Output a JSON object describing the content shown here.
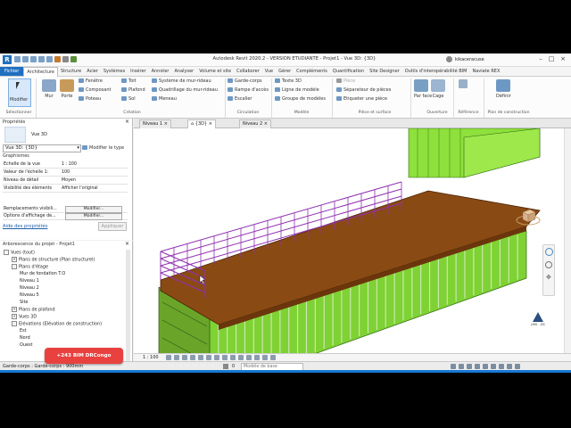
{
  "window": {
    "title": "Autodesk Revit 2020.2 - VERSION ETUDIANTE - Projet1 - Vue 3D: {3D}",
    "user": "kikaceracuse"
  },
  "tabs": [
    "Fichier",
    "Architecture",
    "Structure",
    "Acier",
    "Systèmes",
    "Insérer",
    "Annoter",
    "Analyser",
    "Volume et site",
    "Collaborer",
    "Vue",
    "Gérer",
    "Compléments",
    "Quantification",
    "Site Designer",
    "Outils d'interopérabilité BIM",
    "Naviate REX"
  ],
  "ribbon": {
    "select": {
      "modify": "Modifier",
      "label": "Sélectionner"
    },
    "build": {
      "wall": "Mur",
      "door": "Porte",
      "window": "Fenêtre",
      "component": "Composant",
      "column": "Poteau",
      "roof": "Toit",
      "ceiling": "Plafond",
      "floor": "Sol",
      "curtain_system": "Système de mur-rideau",
      "curtain_grid": "Quadrillage du mur-rideau",
      "mullion": "Meneau",
      "label": "Création"
    },
    "circulation": {
      "railing": "Garde-corps",
      "ramp": "Rampe d'accès",
      "stair": "Escalier",
      "label": "Circulation"
    },
    "model": {
      "model_text": "Texte 3D",
      "model_line": "Ligne de modèle",
      "model_group": "Groupe de modèles",
      "label": "Modèle"
    },
    "room": {
      "room": "Pièce",
      "separator": "Séparateur de pièces",
      "tag": "Etiqueter une pièce",
      "label": "Pièce et surface"
    },
    "opening": {
      "by_face": "Par face",
      "shaft": "Cage",
      "label": "Ouverture"
    },
    "datum": {
      "label": "Référence"
    },
    "work_plane": {
      "set": "Définir",
      "label": "Plan de construction"
    }
  },
  "properties": {
    "title": "Propriétés",
    "type_name": "Vue 3D",
    "selector": "Vue 3D: {3D}",
    "edit_type": "Modifier le type",
    "section": "Graphismes",
    "rows": [
      {
        "k": "Echelle de la vue",
        "v": "1 : 100"
      },
      {
        "k": "Valeur de l'échelle    1:",
        "v": "100"
      },
      {
        "k": "Niveau de détail",
        "v": "Moyen"
      },
      {
        "k": "Visibilité des éléments",
        "v": "Afficher l'original"
      }
    ],
    "vg_overrides": "Remplacements visibili...",
    "vg_button": "Modifier...",
    "display_options": "Options d'affichage de...",
    "display_button": "Modifier...",
    "help": "Aide des propriétés",
    "apply": "Appliquer"
  },
  "browser": {
    "title": "Arborescence du projet - Projet1",
    "items": [
      {
        "t": "Vues (tout)",
        "lvl": 0,
        "pm": "-"
      },
      {
        "t": "Plans de structure (Plan structurel)",
        "lvl": 1,
        "pm": "+"
      },
      {
        "t": "Plans d'étage",
        "lvl": 1,
        "pm": "-"
      },
      {
        "t": "Mur de fondation T.O",
        "lvl": 2,
        "pm": ""
      },
      {
        "t": "Niveau 1",
        "lvl": 2,
        "pm": ""
      },
      {
        "t": "Niveau 2",
        "lvl": 2,
        "pm": ""
      },
      {
        "t": "Niveau 5",
        "lvl": 2,
        "pm": ""
      },
      {
        "t": "Site",
        "lvl": 2,
        "pm": ""
      },
      {
        "t": "Plans de plafond",
        "lvl": 1,
        "pm": "+"
      },
      {
        "t": "Vues 3D",
        "lvl": 1,
        "pm": "+"
      },
      {
        "t": "Elévations (Elévation de construction)",
        "lvl": 1,
        "pm": "-"
      },
      {
        "t": "Est",
        "lvl": 2,
        "pm": ""
      },
      {
        "t": "Nord",
        "lvl": 2,
        "pm": ""
      },
      {
        "t": "Ouest",
        "lvl": 2,
        "pm": ""
      }
    ]
  },
  "view_tabs": [
    "Niveau 1",
    "{3D}",
    "Niveau 2"
  ],
  "view_status": {
    "scale": "1 : 100"
  },
  "status": {
    "left": "Garde-corps : Garde-corps : 900mm",
    "scope": "Modèle de base",
    "value": "0"
  },
  "badge": "+243 BIM DRCongo",
  "logo": "LMS - DC",
  "colors": {
    "container": "#8ee03c",
    "deck": "#8a4a14",
    "railing": "#9030b0",
    "accent": "#1f6fc0"
  }
}
